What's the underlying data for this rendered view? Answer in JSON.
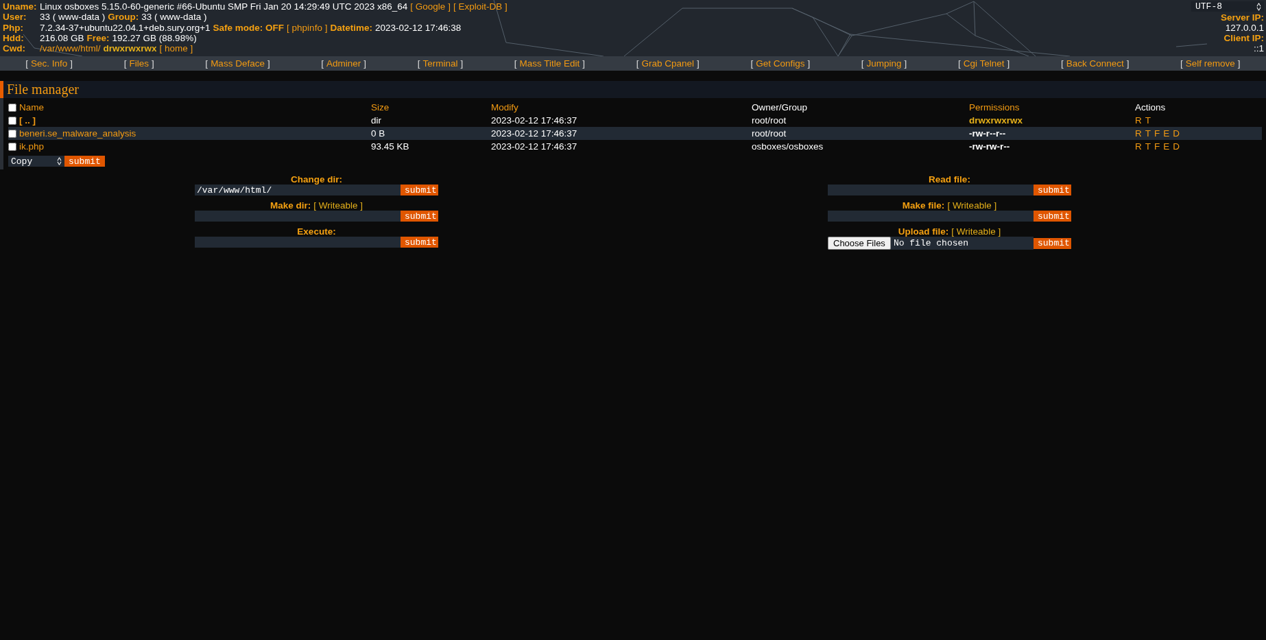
{
  "header": {
    "rows": [
      {
        "label": "Uname:",
        "parts": [
          {
            "kind": "text",
            "text": "Linux osboxes 5.15.0-60-generic #66-Ubuntu SMP Fri Jan 20 14:29:49 UTC 2023 x86_64"
          },
          {
            "kind": "link",
            "text": "[ Google ]"
          },
          {
            "kind": "link",
            "text": "[ Exploit-DB ]"
          }
        ]
      },
      {
        "label": "User:",
        "parts": [
          {
            "kind": "text",
            "text": "33 ( www-data )"
          },
          {
            "kind": "label",
            "text": "Group:"
          },
          {
            "kind": "text",
            "text": "33 ( www-data )"
          }
        ]
      },
      {
        "label": "Php:",
        "parts": [
          {
            "kind": "text",
            "text": "7.2.34-37+ubuntu22.04.1+deb.sury.org+1"
          },
          {
            "kind": "label",
            "text": "Safe mode: OFF"
          },
          {
            "kind": "link",
            "text": "[ phpinfo ]"
          },
          {
            "kind": "label",
            "text": "Datetime:"
          },
          {
            "kind": "text",
            "text": "2023-02-12 17:46:38"
          }
        ]
      },
      {
        "label": "Hdd:",
        "parts": [
          {
            "kind": "text",
            "text": "216.08 GB"
          },
          {
            "kind": "label",
            "text": "Free:"
          },
          {
            "kind": "text",
            "text": "192.27 GB (88.98%)"
          }
        ]
      },
      {
        "label": "Cwd:",
        "parts": [
          {
            "kind": "link",
            "text": "/var/www/html/"
          },
          {
            "kind": "perm",
            "text": "drwxrwxrwx"
          },
          {
            "kind": "link",
            "text": "[ home ]"
          }
        ]
      }
    ],
    "charset": "UTF-8",
    "server_ip": {
      "label": "Server IP:",
      "value": "127.0.0.1"
    },
    "client_ip": {
      "label": "Client IP:",
      "value": "::1"
    }
  },
  "nav": {
    "brackets": [
      "[",
      "]"
    ],
    "items": [
      {
        "label": "Sec. Info"
      },
      {
        "label": "Files"
      },
      {
        "label": "Mass Deface"
      },
      {
        "label": "Adminer"
      },
      {
        "label": "Terminal"
      },
      {
        "label": "Mass Title Edit"
      },
      {
        "label": "Grab Cpanel"
      },
      {
        "label": "Get Configs"
      },
      {
        "label": "Jumping"
      },
      {
        "label": "Cgi Telnet"
      },
      {
        "label": "Back Connect"
      },
      {
        "label": "Self remove"
      }
    ]
  },
  "file_manager": {
    "title": "File manager",
    "select_all_checked": false,
    "columns": [
      {
        "label": "Name",
        "kind": "link"
      },
      {
        "label": "Size",
        "kind": "link"
      },
      {
        "label": "Modify",
        "kind": "link"
      },
      {
        "label": "Owner/Group",
        "kind": "plain"
      },
      {
        "label": "Permissions",
        "kind": "link"
      },
      {
        "label": "Actions",
        "kind": "plain"
      }
    ],
    "rows": [
      {
        "kind": "dir",
        "name": "[ .. ]",
        "size": "dir",
        "modify": "2023-02-12 17:46:37",
        "owner": "root/root",
        "permissions": "drwxrwxrwx",
        "writable": true,
        "actions": [
          "R",
          "T"
        ],
        "checked": false,
        "highlighted": false
      },
      {
        "kind": "file",
        "name": "beneri.se_malware_analysis",
        "size": "0 B",
        "modify": "2023-02-12 17:46:37",
        "owner": "root/root",
        "permissions": "-rw-r--r--",
        "writable": false,
        "actions": [
          "R",
          "T",
          "F",
          "E",
          "D"
        ],
        "checked": false,
        "highlighted": true
      },
      {
        "kind": "file",
        "name": "ik.php",
        "size": "93.45 KB",
        "modify": "2023-02-12 17:46:37",
        "owner": "osboxes/osboxes",
        "permissions": "-rw-rw-r--",
        "writable": false,
        "actions": [
          "R",
          "T",
          "F",
          "E",
          "D"
        ],
        "checked": false,
        "highlighted": false
      }
    ],
    "bulk_action": {
      "value": "Copy",
      "button": "submit"
    }
  },
  "forms": [
    [
      {
        "kind": "text",
        "label": "Change dir:",
        "field": {
          "value": "/var/www/html/"
        },
        "button": "submit"
      },
      {
        "kind": "text",
        "label": "Make dir:",
        "note": "[ Writeable ]",
        "button": "submit"
      },
      {
        "kind": "text",
        "label": "Execute:",
        "button": "submit"
      }
    ],
    [
      {
        "kind": "text",
        "label": "Read file:",
        "button": "submit"
      },
      {
        "kind": "text",
        "label": "Make file:",
        "note": "[ Writeable ]",
        "button": "submit"
      },
      {
        "kind": "file",
        "label": "Upload file:",
        "note": "[ Writeable ]",
        "choose": "Choose Files",
        "status": "No file chosen",
        "button": "submit"
      }
    ]
  ]
}
